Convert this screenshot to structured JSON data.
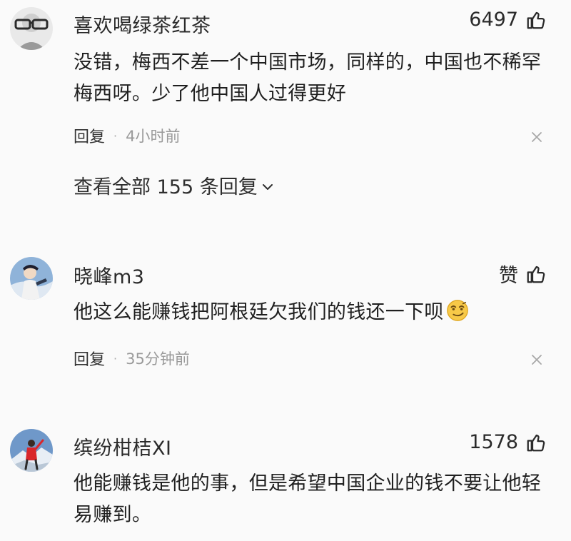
{
  "comments": [
    {
      "username": "喜欢喝绿茶红茶",
      "like_label": "6497",
      "text": "没错，梅西不差一个中国市场，同样的，中国也不稀罕梅西呀。少了他中国人过得更好",
      "reply_label": "回复",
      "separator": "·",
      "time": "4小时前",
      "view_replies": "查看全部 155 条回复"
    },
    {
      "username": "晓峰m3",
      "like_label": "赞",
      "text": "他这么能赚钱把阿根廷欠我们的钱还一下呗",
      "reply_label": "回复",
      "separator": "·",
      "time": "35分钟前"
    },
    {
      "username": "缤纷柑桔XI",
      "like_label": "1578",
      "text": "他能赚钱是他的事，但是希望中国企业的钱不要让他轻易赚到。"
    }
  ],
  "icons": {
    "like": "thumbs-up-icon",
    "close": "close-icon",
    "expand": "chevron-down-icon",
    "emoji": "smirking-face-emoji"
  },
  "colors": {
    "background": "#fafafa",
    "text": "#222222",
    "muted": "#9a9a9a"
  }
}
